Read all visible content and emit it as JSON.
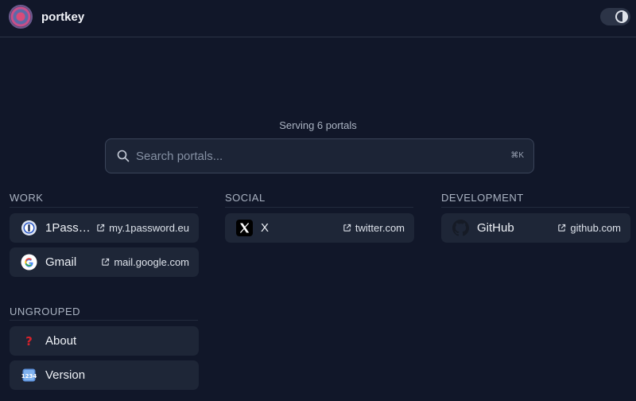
{
  "header": {
    "title": "portkey"
  },
  "subtitle": "Serving 6 portals",
  "search": {
    "placeholder": "Search portals...",
    "shortcut": "⌘K"
  },
  "groups": {
    "work": {
      "title": "WORK",
      "items": [
        {
          "name": "1Password",
          "link": "my.1password.eu",
          "icon": "1password-icon"
        },
        {
          "name": "Gmail",
          "link": "mail.google.com",
          "icon": "google-icon"
        }
      ]
    },
    "social": {
      "title": "SOCIAL",
      "items": [
        {
          "name": "X",
          "link": "twitter.com",
          "icon": "x-icon"
        }
      ]
    },
    "development": {
      "title": "DEVELOPMENT",
      "items": [
        {
          "name": "GitHub",
          "link": "github.com",
          "icon": "github-icon"
        }
      ]
    },
    "ungrouped": {
      "title": "UNGROUPED",
      "items": [
        {
          "name": "About",
          "icon": "question-mark-icon"
        },
        {
          "name": "Version",
          "icon": "numbers-icon"
        }
      ]
    }
  },
  "colors": {
    "background": "#111729",
    "card": "#1e2637",
    "border": "#3a4459"
  }
}
